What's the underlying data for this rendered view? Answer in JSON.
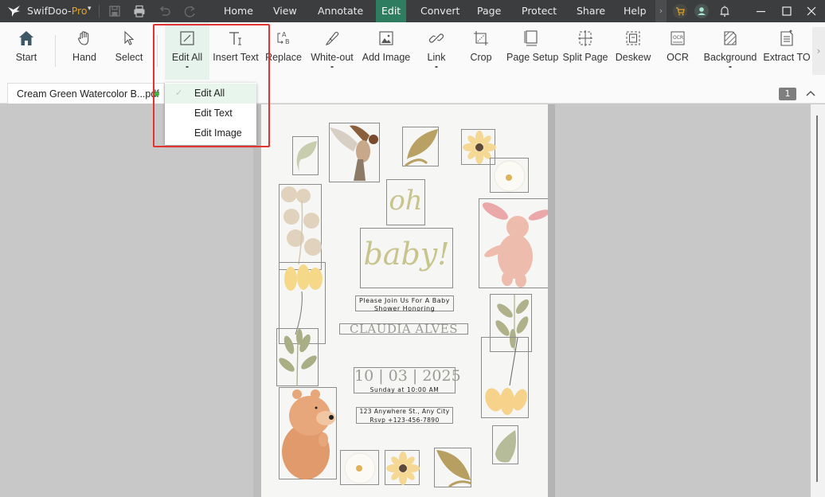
{
  "app": {
    "name": "SwifDoo-",
    "name_suffix": "Pro",
    "caret": "▾"
  },
  "menu": {
    "items": [
      "Home",
      "View",
      "Annotate",
      "Edit",
      "Convert",
      "Page",
      "Protect",
      "Share",
      "Help"
    ],
    "active": "Edit",
    "more": "›"
  },
  "ribbon": {
    "tools": [
      {
        "id": "start",
        "label": "Start",
        "icon": "home-icon"
      },
      {
        "id": "hand",
        "label": "Hand",
        "icon": "hand-icon"
      },
      {
        "id": "select",
        "label": "Select",
        "icon": "cursor-icon"
      },
      {
        "id": "edit-all",
        "label": "Edit All",
        "icon": "edit-box-icon",
        "dropdown": true,
        "active": true
      },
      {
        "id": "insert-text",
        "label": "Insert Text",
        "icon": "text-cursor-icon"
      },
      {
        "id": "replace",
        "label": "Replace",
        "icon": "replace-ab-icon"
      },
      {
        "id": "white-out",
        "label": "White-out",
        "icon": "eraser-pen-icon",
        "dropdown": true
      },
      {
        "id": "add-image",
        "label": "Add Image",
        "icon": "image-icon"
      },
      {
        "id": "link",
        "label": "Link",
        "icon": "link-icon",
        "dropdown": true
      },
      {
        "id": "crop",
        "label": "Crop",
        "icon": "crop-icon"
      },
      {
        "id": "page-setup",
        "label": "Page Setup",
        "icon": "page-setup-icon"
      },
      {
        "id": "split-page",
        "label": "Split Page",
        "icon": "split-page-icon"
      },
      {
        "id": "deskew",
        "label": "Deskew",
        "icon": "deskew-icon"
      },
      {
        "id": "ocr",
        "label": "OCR",
        "icon": "ocr-icon"
      },
      {
        "id": "background",
        "label": "Background",
        "icon": "background-icon",
        "dropdown": true
      },
      {
        "id": "extract-toc",
        "label": "Extract TO",
        "icon": "extract-toc-icon"
      }
    ],
    "scroll_right": "›"
  },
  "tabs": {
    "document": "Cream Green Watercolor B...pdf",
    "unsaved_indicator_color": "#3fb53f",
    "page_number": "1"
  },
  "dropdown": {
    "items": [
      {
        "label": "Edit All",
        "selected": true
      },
      {
        "label": "Edit Text",
        "selected": false
      },
      {
        "label": "Edit Image",
        "selected": false
      }
    ],
    "check": "✓"
  },
  "document": {
    "oh": "oh",
    "baby": "baby!",
    "invite_line1": "Please Join Us For A Baby",
    "invite_line2": "Shower Honoring",
    "name": "CLAUDIA ALVES",
    "date": "10 | 03 | 2025",
    "time": "Sunday at 10:00 AM",
    "address": "123 Anywhere St., Any City",
    "rsvp": "Rsvp +123-456-7890"
  },
  "colors": {
    "accent": "#2f7d60",
    "pro": "#e0a326",
    "highlight": "#e23232",
    "script_text": "#c8c48e"
  }
}
